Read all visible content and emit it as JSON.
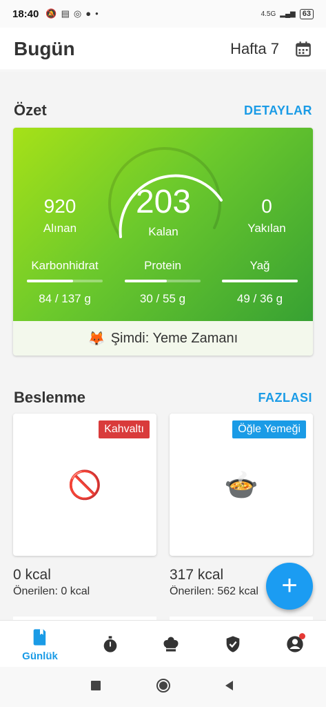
{
  "status_bar": {
    "time": "18:40",
    "network": "4.5G",
    "battery": "63"
  },
  "header": {
    "title": "Bugün",
    "week": "Hafta 7"
  },
  "summary": {
    "title": "Özet",
    "link": "DETAYLAR",
    "eaten": {
      "value": "920",
      "label": "Alınan"
    },
    "remaining": {
      "value": "203",
      "label": "Kalan"
    },
    "burned": {
      "value": "0",
      "label": "Yakılan"
    },
    "macros": [
      {
        "name": "Karbonhidrat",
        "value": "84 / 137 g",
        "progress": 0.61
      },
      {
        "name": "Protein",
        "value": "30 / 55 g",
        "progress": 0.55
      },
      {
        "name": "Yağ",
        "value": "49 / 36 g",
        "progress": 1.0
      }
    ],
    "eat_now_icon": "🦊",
    "eat_now": "Şimdi: Yeme Zamanı"
  },
  "nutrition": {
    "title": "Beslenme",
    "link": "FAZLASI",
    "meals": [
      {
        "badge": "Kahvaltı",
        "badge_color": "#d93b3b",
        "emoji": "🚫",
        "kcal": "0 kcal",
        "suggested": "Önerilen: 0 kcal"
      },
      {
        "badge": "Öğle Yemeği",
        "badge_color": "#1a9be6",
        "emoji": "🍲",
        "kcal": "317 kcal",
        "suggested": "Önerilen: 562 kcal"
      }
    ]
  },
  "fab": {
    "label": "+"
  },
  "nav": {
    "active_label": "Günlük",
    "accent": "#1a9be6"
  }
}
